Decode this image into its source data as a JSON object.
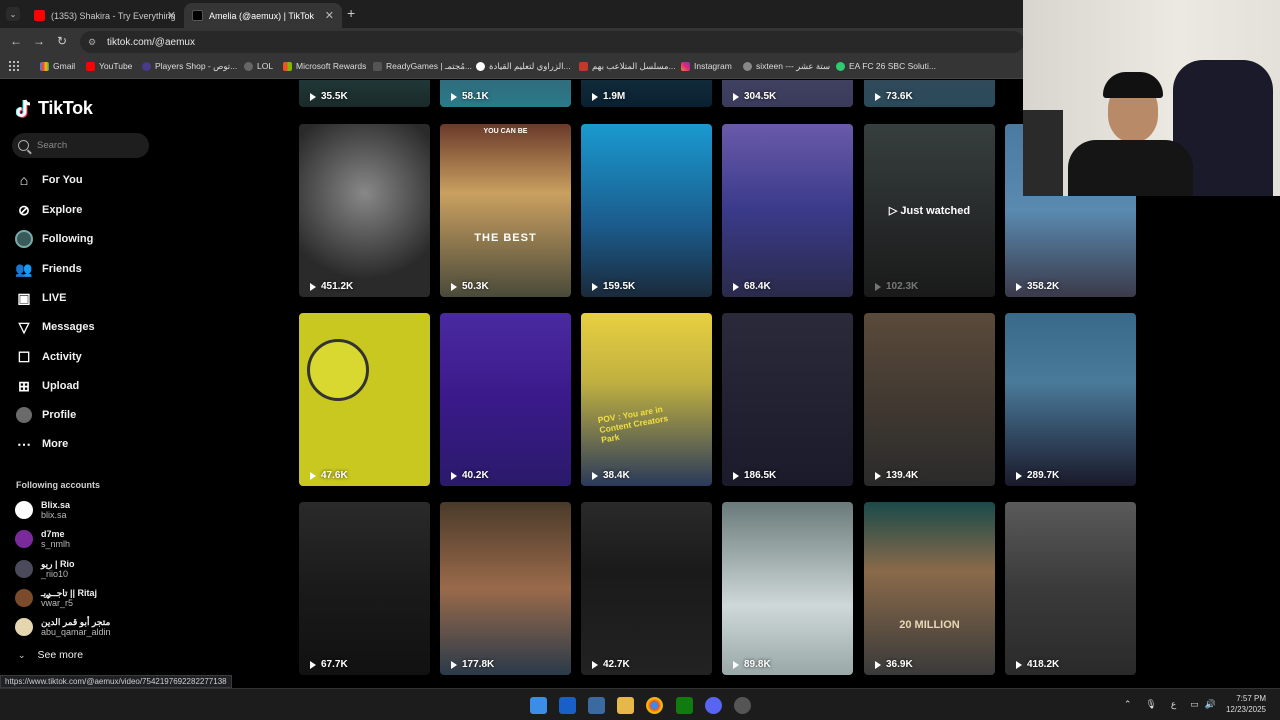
{
  "browser": {
    "tabs": [
      {
        "title": "(1353) Shakira - Try Everything",
        "active": false
      },
      {
        "title": "Amelia (@aemux) | TikTok",
        "active": true
      }
    ],
    "url": "tiktok.com/@aemux",
    "bookmarks": [
      "Gmail",
      "YouTube",
      "Players Shop - توص...",
      "LOL",
      "Microsoft Rewards",
      "ReadyGames | مُجتمـ...",
      "الزراوي لتعليم القيادة...",
      "مسلسل المتلاعب بهم...",
      "Instagram",
      "sixteen --- ستة عشر",
      "EA FC 26 SBC Soluti..."
    ]
  },
  "sidebar": {
    "logo": "TikTok",
    "search_placeholder": "Search",
    "nav": [
      {
        "label": "For You",
        "icon": "home-icon"
      },
      {
        "label": "Explore",
        "icon": "compass-icon"
      },
      {
        "label": "Following",
        "icon": "following-avatar-icon"
      },
      {
        "label": "Friends",
        "icon": "friends-icon"
      },
      {
        "label": "LIVE",
        "icon": "live-icon"
      },
      {
        "label": "Messages",
        "icon": "messages-icon"
      },
      {
        "label": "Activity",
        "icon": "activity-icon"
      },
      {
        "label": "Upload",
        "icon": "upload-icon"
      },
      {
        "label": "Profile",
        "icon": "profile-icon"
      },
      {
        "label": "More",
        "icon": "more-icon"
      }
    ],
    "following_title": "Following accounts",
    "accounts": [
      {
        "display": "Blix.sa",
        "user": "blix.sa"
      },
      {
        "display": "d7me",
        "user": "s_nmlh"
      },
      {
        "display": "ريو | Rio",
        "user": "_riio10"
      },
      {
        "display": "تاجــࢪيـ || Ritaj",
        "user": "vwar_r5"
      },
      {
        "display": "متجر أبو قمر الدين",
        "user": "abu_qamar_aldin"
      }
    ],
    "see_more": "See more"
  },
  "grid": {
    "rows": [
      [
        "35.5K",
        "58.1K",
        "1.9M",
        "304.5K",
        "73.6K"
      ],
      [
        "451.2K",
        "50.3K",
        "159.5K",
        "68.4K",
        "102.3K",
        "358.2K"
      ],
      [
        "47.6K",
        "40.2K",
        "38.4K",
        "186.5K",
        "139.4K",
        "289.7K"
      ],
      [
        "67.7K",
        "177.8K",
        "42.7K",
        "89.8K",
        "36.9K",
        "418.2K"
      ]
    ],
    "just_watched": "Just watched",
    "overlay_you_can_be": "YOU CAN BE",
    "overlay_the_best": "THE BEST",
    "overlay_pov": "POV : You are in Content Creators Park",
    "overlay_million": "20 MILLION"
  },
  "status_url": "https://www.tiktok.com/@aemux/video/7542197692282277138",
  "taskbar": {
    "time": "7:57 PM",
    "date": "12/23/2025",
    "lang": "ع"
  }
}
